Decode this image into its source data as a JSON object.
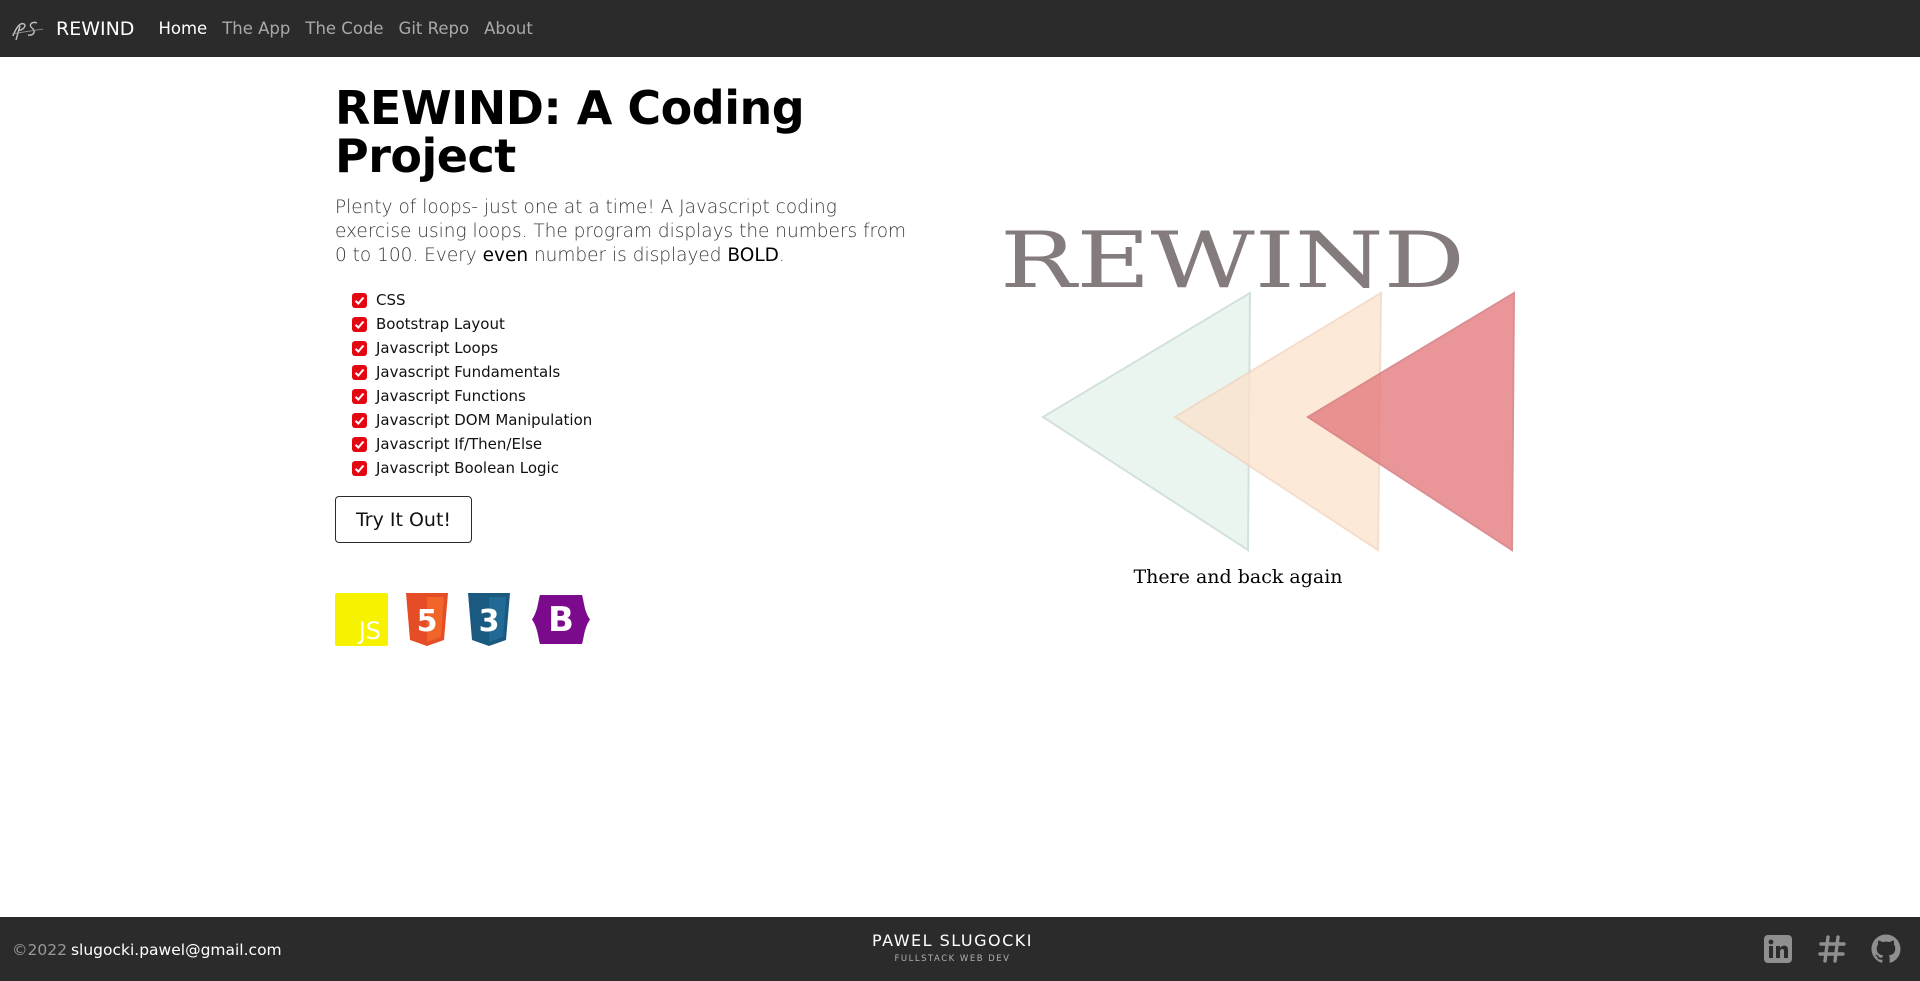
{
  "nav": {
    "brand": "REWIND",
    "links": [
      {
        "label": "Home",
        "active": true
      },
      {
        "label": "The App",
        "active": false
      },
      {
        "label": "The Code",
        "active": false
      },
      {
        "label": "Git Repo",
        "active": false
      },
      {
        "label": "About",
        "active": false
      }
    ]
  },
  "main": {
    "title_line1": "REWIND: A Coding",
    "title_line2": "Project",
    "desc_part1": "Plenty of loops- just one at a time! A Javascript coding exercise using loops. The program displays the numbers from 0 to 100. Every ",
    "desc_even": "even",
    "desc_part2": " number is displayed ",
    "desc_bold": "BOLD",
    "desc_end": ".",
    "checklist": [
      "CSS",
      "Bootstrap Layout",
      "Javascript Loops",
      "Javascript Fundamentals",
      "Javascript Functions",
      "Javascript DOM Manipulation",
      "Javascript If/Then/Else",
      "Javascript Boolean Logic"
    ],
    "button_label": "Try It Out!",
    "tech_logos": {
      "js": "JS",
      "html": "5",
      "css": "3",
      "bootstrap": "B"
    }
  },
  "hero": {
    "wordmark": "REWIND",
    "caption": "There and back again"
  },
  "footer": {
    "copyright": "©2022",
    "email": "slugocki.pawel@gmail.com",
    "name": "PAWEL SLUGOCKI",
    "subtitle": "FULLSTACK WEB DEV"
  },
  "icons": {
    "brand": "ps-logo-icon",
    "check": "checkbox-checked-icon",
    "socials": [
      "linkedin-icon",
      "hashtag-icon",
      "github-icon"
    ]
  },
  "colors": {
    "navbar_bg": "#2b2b2b",
    "check_red": "#e30613",
    "js_yellow": "#f7f300",
    "html_orange": "#e44d26",
    "css_blue": "#1b5a80",
    "bootstrap_purple": "#7b0a8c",
    "triangle_teal": "#e8f4ef",
    "triangle_peach": "#fde2cc",
    "triangle_red": "#e57c80",
    "wordmark_gray": "#847b7c"
  }
}
